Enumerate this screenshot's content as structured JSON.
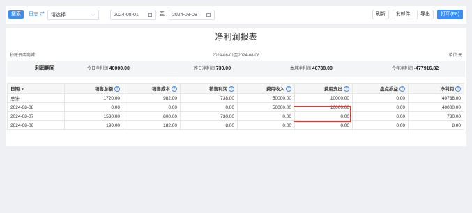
{
  "toolbar": {
    "search_label": "搜索",
    "log_label": "日志",
    "select_placeholder": "请选择",
    "date_start": "2024-08-01",
    "date_sep": "至",
    "date_end": "2024-08-08",
    "refresh_label": "刷新",
    "mail_label": "发邮件",
    "export_label": "导出",
    "print_label": "打印(F8)"
  },
  "report": {
    "title": "净利润报表",
    "shop": "秒账云店商城",
    "period": "2024-08-01至2024-08-08",
    "unit": "单位:元"
  },
  "summary": {
    "period_label": "利润期间",
    "today_label": "今日净利润",
    "today_value": "40000.00",
    "yesterday_label": "昨日净利润",
    "yesterday_value": "730.00",
    "month_label": "本月净利润",
    "month_value": "40738.00",
    "year_label": "今年净利润",
    "year_value": "-477916.82"
  },
  "table": {
    "headers": [
      "日期",
      "销售总额",
      "销售成本",
      "销售利润",
      "费用收入",
      "费用支出",
      "盘点损益",
      "净利润"
    ],
    "rows": [
      [
        "总计",
        "1720.00",
        "982.00",
        "738.00",
        "50000.00",
        "10000.00",
        "0.00",
        "40738.00"
      ],
      [
        "2024-08-08",
        "0.00",
        "0.00",
        "0.00",
        "50000.00",
        "10000.00",
        "0.00",
        "40000.00"
      ],
      [
        "2024-08-07",
        "1530.00",
        "800.00",
        "730.00",
        "0.00",
        "0.00",
        "0.00",
        "730.00"
      ],
      [
        "2024-08-06",
        "190.00",
        "182.00",
        "8.00",
        "0.00",
        "0.00",
        "0.00",
        "8.00"
      ]
    ]
  },
  "colors": {
    "accent": "#3b8ef6",
    "highlight": "#e53935"
  },
  "icons": [
    "link-icon",
    "chevron-down-icon",
    "calendar-icon",
    "help-icon",
    "sort-caret-icon"
  ]
}
